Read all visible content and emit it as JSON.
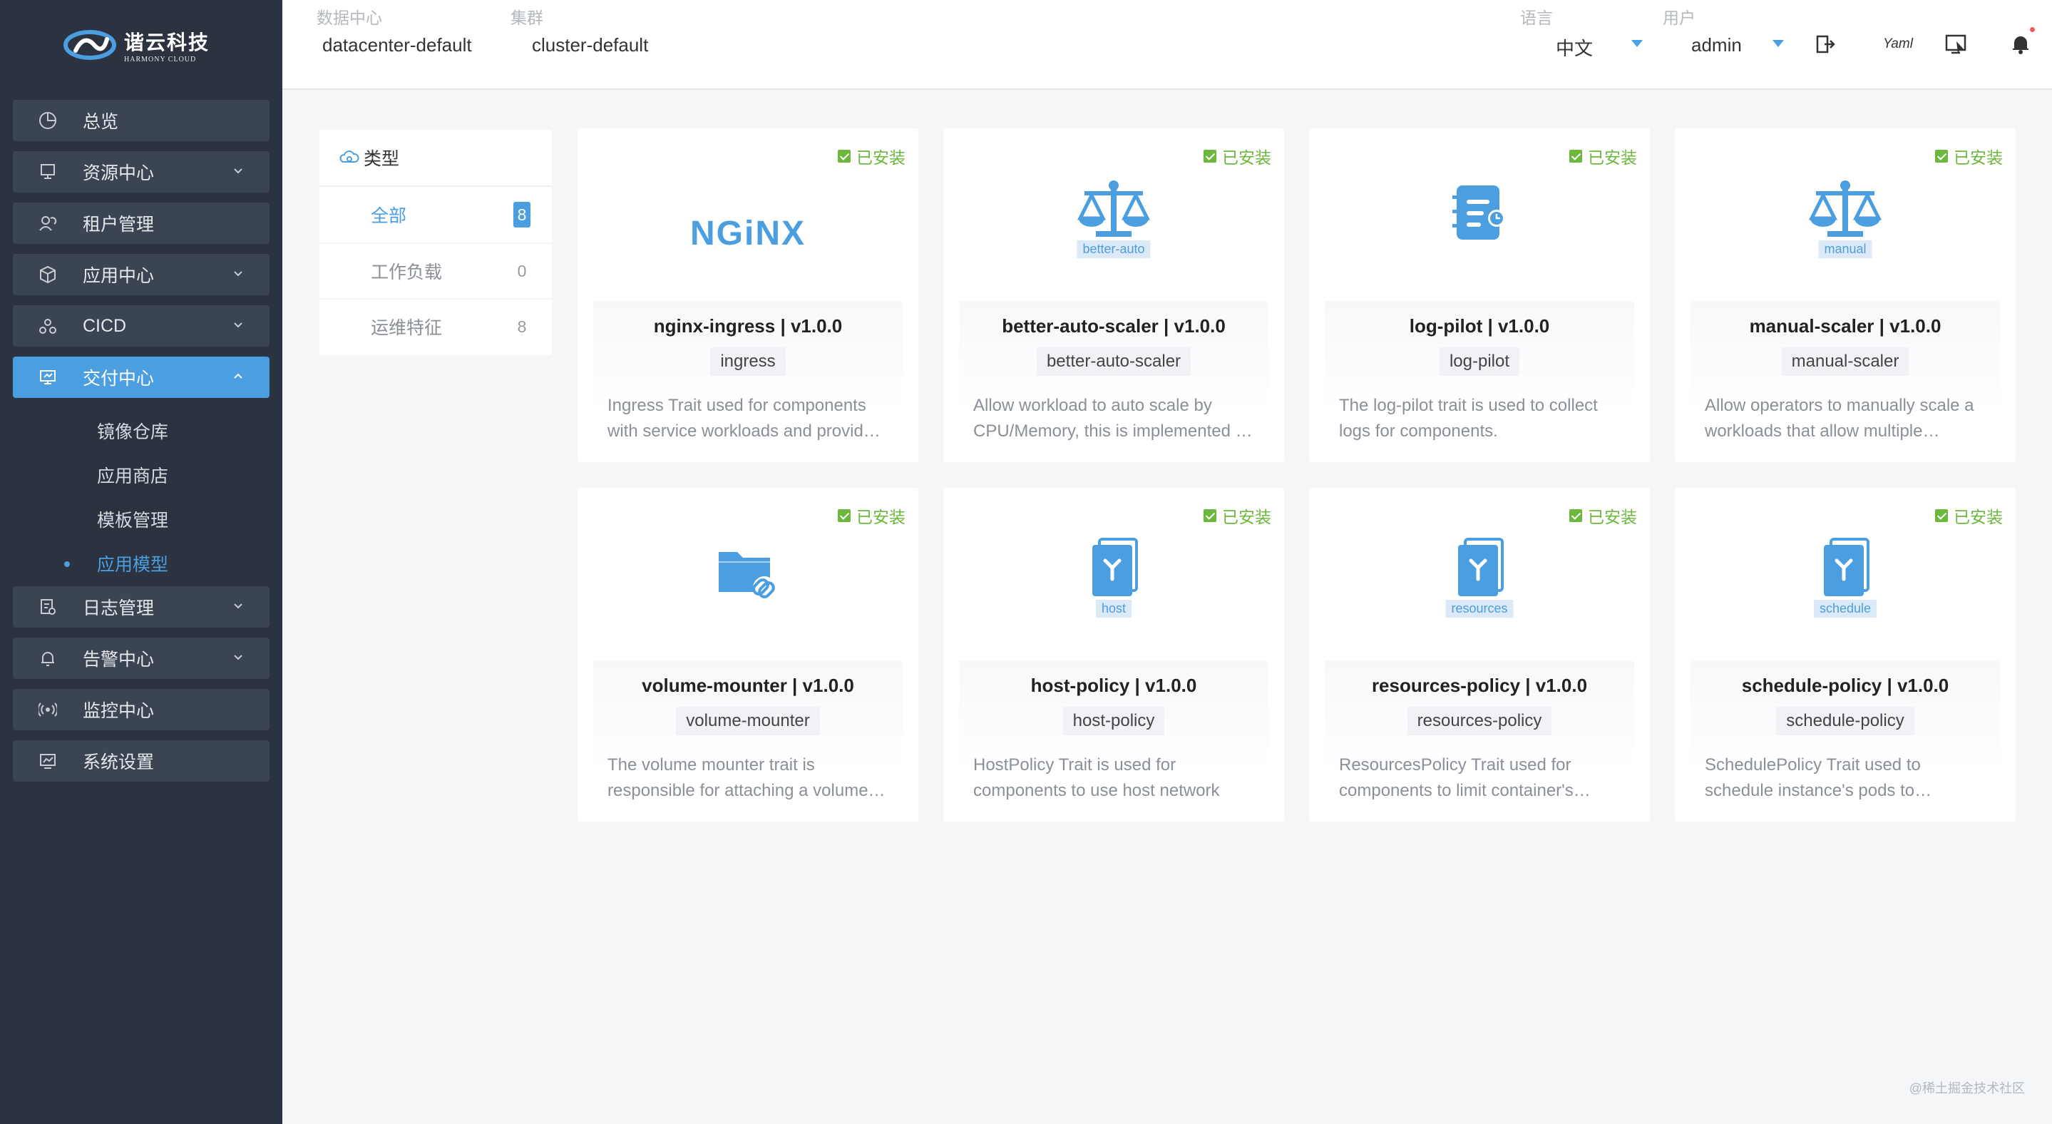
{
  "brand": {
    "name_cn": "谐云科技",
    "name_en": "HARMONY CLOUD"
  },
  "sidebar": {
    "items": [
      {
        "label": "总览",
        "icon": "pie-chart-icon",
        "expandable": false
      },
      {
        "label": "资源中心",
        "icon": "server-icon",
        "expandable": true
      },
      {
        "label": "租户管理",
        "icon": "users-icon",
        "expandable": false
      },
      {
        "label": "应用中心",
        "icon": "cube-icon",
        "expandable": true
      },
      {
        "label": "CICD",
        "icon": "pipeline-icon",
        "expandable": true
      },
      {
        "label": "交付中心",
        "icon": "monitor-icon",
        "expandable": true,
        "active": true
      },
      {
        "label": "日志管理",
        "icon": "log-icon",
        "expandable": true
      },
      {
        "label": "告警中心",
        "icon": "bell-icon",
        "expandable": true
      },
      {
        "label": "监控中心",
        "icon": "signal-icon",
        "expandable": false
      },
      {
        "label": "系统设置",
        "icon": "settings-chart-icon",
        "expandable": false
      }
    ],
    "subitems": [
      {
        "label": "镜像仓库"
      },
      {
        "label": "应用商店"
      },
      {
        "label": "模板管理"
      },
      {
        "label": "应用模型",
        "active": true
      }
    ]
  },
  "header": {
    "datacenter": {
      "label": "数据中心",
      "value": "datacenter-default"
    },
    "cluster": {
      "label": "集群",
      "value": "cluster-default"
    },
    "language": {
      "label": "语言",
      "value": "中文"
    },
    "user": {
      "label": "用户",
      "value": "admin"
    },
    "yaml_label": "Yaml"
  },
  "filter": {
    "title": "类型",
    "options": [
      {
        "label": "全部",
        "count": "8",
        "active": true
      },
      {
        "label": "工作负载",
        "count": "0"
      },
      {
        "label": "运维特征",
        "count": "8"
      }
    ]
  },
  "status_label": "已安装",
  "cards": [
    {
      "title": "nginx-ingress | v1.0.0",
      "tag": "ingress",
      "desc": "Ingress Trait used for components with service workloads and provides ingress access",
      "visual": "nginx-logo",
      "logo_text": "NGiNX"
    },
    {
      "title": "better-auto-scaler | v1.0.0",
      "tag": "better-auto-scaler",
      "desc": "Allow workload to auto scale by CPU/Memory, this is implemented by HPA",
      "visual": "scale-icon",
      "icon_tag": "better-auto"
    },
    {
      "title": "log-pilot | v1.0.0",
      "tag": "log-pilot",
      "desc": "The log-pilot trait is used to collect logs for components.",
      "visual": "log-icon"
    },
    {
      "title": "manual-scaler | v1.0.0",
      "tag": "manual-scaler",
      "desc": "Allow operators to manually scale a workloads that allow multiple replicas",
      "visual": "scale-icon",
      "icon_tag": "manual"
    },
    {
      "title": "volume-mounter | v1.0.0",
      "tag": "volume-mounter",
      "desc": "The volume mounter trait is responsible for attaching a volume to components",
      "visual": "folder-link-icon"
    },
    {
      "title": "host-policy | v1.0.0",
      "tag": "host-policy",
      "desc": "HostPolicy Trait is used for components to use host network",
      "visual": "book-icon",
      "icon_tag": "host"
    },
    {
      "title": "resources-policy | v1.0.0",
      "tag": "resources-policy",
      "desc": "ResourcesPolicy Trait used for components to limit container's resources",
      "visual": "book-icon",
      "icon_tag": "resources"
    },
    {
      "title": "schedule-policy | v1.0.0",
      "tag": "schedule-policy",
      "desc": "SchedulePolicy Trait used to schedule instance's pods to expected nodes",
      "visual": "book-icon",
      "icon_tag": "schedule"
    }
  ],
  "watermark": "@稀土掘金技术社区",
  "colors": {
    "sidebar_bg": "#2c3340",
    "accent": "#4b9ee0",
    "installed": "#6bb83c"
  }
}
